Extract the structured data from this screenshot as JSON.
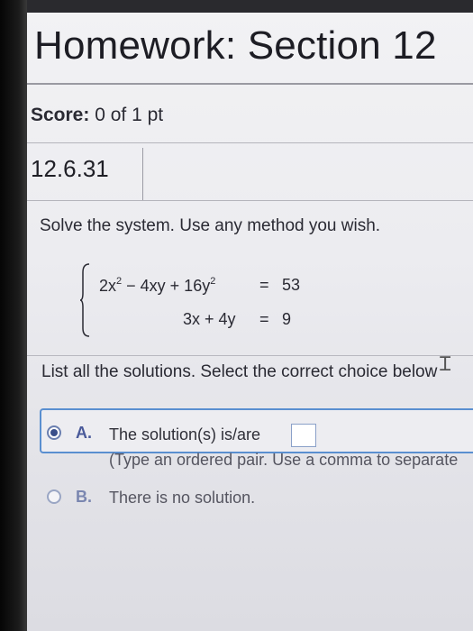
{
  "header": {
    "title": "Homework: Section 12"
  },
  "score": {
    "label": "Score:",
    "value": "0 of 1 pt"
  },
  "question": {
    "number": "12.6.31"
  },
  "problem": {
    "prompt": "Solve the system. Use any method you wish.",
    "eq1": {
      "lhs_a": "2x",
      "exp": "2",
      "lhs_b": " − 4xy + 16y",
      "exp2": "2",
      "rel": "=",
      "rhs": "53"
    },
    "eq2": {
      "lhs": "3x + 4y",
      "rel": "=",
      "rhs": "9"
    }
  },
  "instruction": "List all the solutions. Select the correct choice below",
  "choices": [
    {
      "letter": "A.",
      "text": "The solution(s) is/are",
      "hint": "(Type an ordered pair. Use a comma to separate",
      "selected": true
    },
    {
      "letter": "B.",
      "text": "There is no solution.",
      "selected": false
    }
  ]
}
